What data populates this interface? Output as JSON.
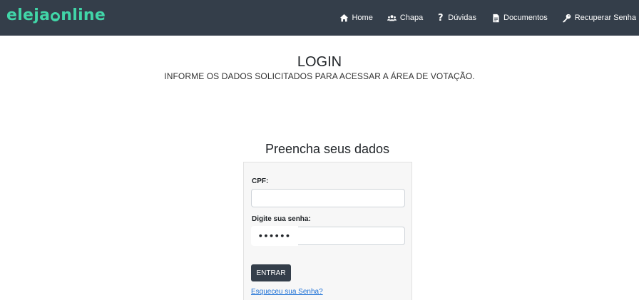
{
  "brand": {
    "part1": "eleja",
    "part2": "nline"
  },
  "nav": {
    "home": "Home",
    "chapa": "Chapa",
    "duvidas": "Dúvidas",
    "documentos": "Documentos",
    "recuperar": "Recuperar Senha"
  },
  "page": {
    "title": "LOGIN",
    "subtitle": "INFORME OS DADOS SOLICITADOS PARA ACESSAR A ÁREA DE VOTAÇÃO."
  },
  "form": {
    "heading": "Preencha seus dados",
    "cpf_label": "CPF:",
    "cpf_value": "",
    "senha_label": "Digite sua senha:",
    "senha_display": "••••••",
    "submit_label": "ENTRAR",
    "forgot_link": "Esqueceu sua Senha?"
  },
  "colors": {
    "navbar": "#343e4a",
    "brand": "#41d6a8",
    "button": "#343e4a",
    "link": "#1a6fd6"
  },
  "icons": {
    "home": "home-icon",
    "chapa": "users-icon",
    "duvidas": "question-icon",
    "documentos": "document-icon",
    "recuperar": "key-icon"
  }
}
